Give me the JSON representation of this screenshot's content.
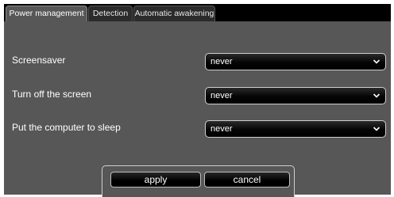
{
  "tabs": [
    {
      "label": "Power management",
      "active": true
    },
    {
      "label": "Detection",
      "active": false
    },
    {
      "label": "Automatic awakening",
      "active": false
    }
  ],
  "settings": [
    {
      "label": "Screensaver",
      "value": "never"
    },
    {
      "label": "Turn off the screen",
      "value": "never"
    },
    {
      "label": "Put the computer to sleep",
      "value": "never"
    }
  ],
  "buttons": {
    "apply": "apply",
    "cancel": "cancel"
  },
  "colors": {
    "panel": "#575757",
    "tabbar": "#000000",
    "text": "#ffffff"
  },
  "icons": {
    "dropdown": "chevron-down-icon"
  }
}
